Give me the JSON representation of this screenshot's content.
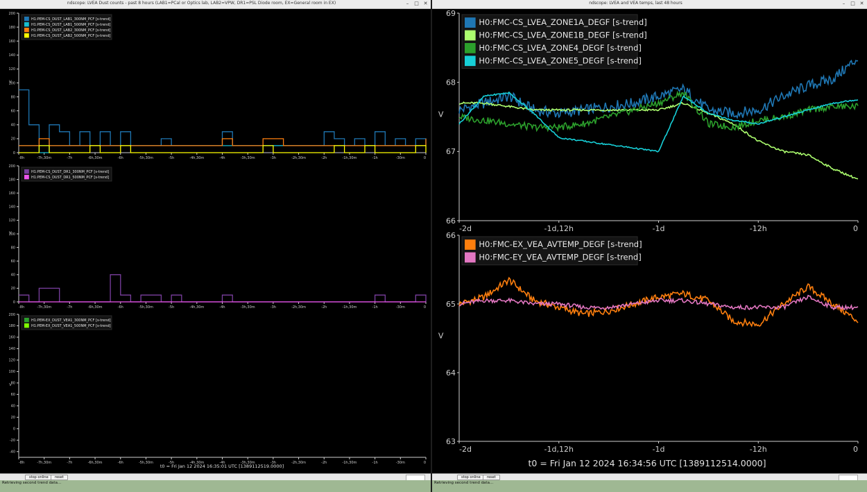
{
  "left_window": {
    "title": "ndscope: LVEA Dust counts - past 8 hours (LAB1=PCal or Optics lab, LAB2=VPW, DR1=PSL Diode room, EX=General room in EX)",
    "t0": "t0 = Fri Jan 12 2024 16:35:01 UTC [1389112519.0000]",
    "stop_label": "stop online",
    "reset_label": "reset",
    "status": "Retrieving second trend data...",
    "ylabel": "V",
    "x_ticks": [
      "-8h",
      "-7h,30m",
      "-7h",
      "-6h,30m",
      "-6h",
      "-5h,30m",
      "-5h",
      "-4h,30m",
      "-4h",
      "-3h,30m",
      "-3h",
      "-2h,30m",
      "-2h",
      "-1h,30m",
      "-1h",
      "-30m",
      "0"
    ],
    "panels": [
      {
        "ylim": [
          0,
          200
        ],
        "y_ticks": [
          0,
          20,
          40,
          60,
          80,
          100,
          120,
          140,
          160,
          180,
          200
        ],
        "legend": [
          {
            "name": "H1:PEM-CS_DUST_LAB1_300NM_PCF [s-trend]",
            "color": "#1f77b4"
          },
          {
            "name": "H1:PEM-CS_DUST_LAB1_500NM_PCF [s-trend]",
            "color": "#17becf"
          },
          {
            "name": "H1:PEM-CS_DUST_LAB2_300NM_PCF [s-trend]",
            "color": "#ff7f0e"
          },
          {
            "name": "H1:PEM-CS_DUST_LAB2_500NM_PCF [s-trend]",
            "color": "#ffff00"
          }
        ]
      },
      {
        "ylim": [
          0,
          200
        ],
        "y_ticks": [
          0,
          20,
          40,
          60,
          80,
          100,
          120,
          140,
          160,
          180,
          200
        ],
        "legend": [
          {
            "name": "H1:PEM-CS_DUST_DR1_300NM_PCF [s-trend]",
            "color": "#7b3fa0"
          },
          {
            "name": "H1:PEM-CS_DUST_DR1_500NM_PCF [s-trend]",
            "color": "#ee55ee"
          }
        ]
      },
      {
        "ylim": [
          -50,
          200
        ],
        "y_ticks": [
          -40,
          -20,
          0,
          20,
          40,
          60,
          80,
          100,
          120,
          140,
          160,
          180,
          200
        ],
        "legend": [
          {
            "name": "H1:PEM-EX_DUST_VEA1_300NM_PCF [s-trend]",
            "color": "#2ca02c"
          },
          {
            "name": "H1:PEM-EX_DUST_VEA1_500NM_PCF [s-trend]",
            "color": "#7fff00"
          }
        ]
      }
    ]
  },
  "right_window": {
    "title": "ndscope: LVEA and VEA temps, last 48 hours",
    "t0": "t0 = Fri Jan 12 2024 16:34:56 UTC [1389112514.0000]",
    "stop_label": "stop online",
    "reset_label": "reset",
    "status": "Retrieving second trend data...",
    "ylabel": "V",
    "x_ticks": [
      "-2d",
      "-1d,12h",
      "-1d",
      "-12h",
      "0"
    ],
    "panels": [
      {
        "ylim": [
          66,
          69
        ],
        "y_ticks": [
          66,
          67,
          68,
          69
        ],
        "legend": [
          {
            "name": "H0:FMC-CS_LVEA_ZONE1A_DEGF [s-trend]",
            "color": "#1f77b4"
          },
          {
            "name": "H0:FMC-CS_LVEA_ZONE1B_DEGF [s-trend]",
            "color": "#adff6f"
          },
          {
            "name": "H0:FMC-CS_LVEA_ZONE4_DEGF [s-trend]",
            "color": "#2ca02c"
          },
          {
            "name": "H0:FMC-CS_LVEA_ZONE5_DEGF [s-trend]",
            "color": "#17d0d8"
          }
        ]
      },
      {
        "ylim": [
          63,
          66
        ],
        "y_ticks": [
          63,
          64,
          65,
          66
        ],
        "legend": [
          {
            "name": "H0:FMC-EX_VEA_AVTEMP_DEGF [s-trend]",
            "color": "#ff7f0e"
          },
          {
            "name": "H0:FMC-EY_VEA_AVTEMP_DEGF [s-trend]",
            "color": "#e377c2"
          }
        ]
      }
    ]
  },
  "chart_data": [
    {
      "type": "line",
      "xlabel": "",
      "ylabel": "V",
      "ylim": [
        0,
        200
      ],
      "x": [
        -8,
        -7.8,
        -7.6,
        -7.4,
        -7.2,
        -7,
        -6.8,
        -6.6,
        -6.4,
        -6.2,
        -6,
        -5.8,
        -5.6,
        -5.4,
        -5.2,
        -5,
        -4.8,
        -4.6,
        -4.4,
        -4.2,
        -4,
        -3.8,
        -3.6,
        -3.4,
        -3.2,
        -3,
        -2.8,
        -2.6,
        -2.4,
        -2.2,
        -2,
        -1.8,
        -1.6,
        -1.4,
        -1.2,
        -1,
        -0.8,
        -0.6,
        -0.4,
        -0.2,
        0
      ],
      "series": [
        {
          "name": "H1:PEM-CS_DUST_LAB1_300NM_PCF [s-trend]",
          "values": [
            90,
            40,
            10,
            40,
            30,
            10,
            30,
            10,
            30,
            10,
            30,
            10,
            10,
            10,
            20,
            10,
            10,
            10,
            10,
            10,
            30,
            10,
            10,
            10,
            10,
            10,
            10,
            10,
            10,
            10,
            30,
            20,
            10,
            20,
            10,
            30,
            10,
            20,
            10,
            20,
            10
          ]
        },
        {
          "name": "H1:PEM-CS_DUST_LAB1_500NM_PCF [s-trend]",
          "values": [
            10,
            10,
            0,
            10,
            10,
            10,
            10,
            10,
            10,
            10,
            10,
            10,
            10,
            10,
            10,
            10,
            10,
            10,
            10,
            10,
            10,
            10,
            10,
            10,
            10,
            10,
            10,
            10,
            10,
            10,
            10,
            10,
            10,
            10,
            10,
            10,
            10,
            10,
            10,
            10,
            10
          ]
        },
        {
          "name": "H1:PEM-CS_DUST_LAB2_300NM_PCF [s-trend]",
          "values": [
            10,
            10,
            20,
            10,
            10,
            10,
            10,
            10,
            10,
            10,
            10,
            10,
            10,
            10,
            10,
            10,
            10,
            10,
            10,
            10,
            20,
            10,
            10,
            10,
            20,
            20,
            10,
            10,
            10,
            10,
            10,
            10,
            10,
            10,
            10,
            10,
            10,
            10,
            10,
            10,
            20
          ]
        },
        {
          "name": "H1:PEM-CS_DUST_LAB2_500NM_PCF [s-trend]",
          "values": [
            0,
            0,
            10,
            0,
            0,
            0,
            0,
            10,
            0,
            0,
            10,
            0,
            0,
            0,
            0,
            0,
            0,
            0,
            0,
            0,
            0,
            0,
            0,
            0,
            10,
            0,
            0,
            0,
            0,
            0,
            0,
            10,
            0,
            0,
            10,
            0,
            0,
            0,
            0,
            10,
            0
          ]
        }
      ]
    },
    {
      "type": "line",
      "xlabel": "",
      "ylabel": "V",
      "ylim": [
        0,
        200
      ],
      "x": [
        -8,
        -7.8,
        -7.6,
        -7.4,
        -7.2,
        -7,
        -6.8,
        -6.6,
        -6.4,
        -6.2,
        -6,
        -5.8,
        -5.6,
        -5.4,
        -5.2,
        -5,
        -4.8,
        -4.6,
        -4.4,
        -4.2,
        -4,
        -3.8,
        -3.6,
        -3.4,
        -3.2,
        -3,
        -2.8,
        -2.6,
        -2.4,
        -2.2,
        -2,
        -1.8,
        -1.6,
        -1.4,
        -1.2,
        -1,
        -0.8,
        -0.6,
        -0.4,
        -0.2,
        0
      ],
      "series": [
        {
          "name": "H1:PEM-CS_DUST_DR1_300NM_PCF [s-trend]",
          "values": [
            10,
            0,
            20,
            20,
            0,
            0,
            0,
            0,
            0,
            40,
            10,
            0,
            10,
            10,
            0,
            10,
            0,
            0,
            0,
            0,
            10,
            0,
            0,
            0,
            0,
            0,
            0,
            0,
            0,
            0,
            0,
            0,
            0,
            0,
            0,
            10,
            0,
            0,
            0,
            10,
            0
          ]
        },
        {
          "name": "H1:PEM-CS_DUST_DR1_500NM_PCF [s-trend]",
          "values": [
            0,
            0,
            0,
            0,
            0,
            0,
            0,
            0,
            0,
            0,
            0,
            0,
            0,
            0,
            0,
            0,
            0,
            0,
            0,
            0,
            0,
            0,
            0,
            0,
            0,
            0,
            0,
            0,
            0,
            0,
            0,
            0,
            0,
            0,
            0,
            0,
            0,
            0,
            0,
            0,
            0
          ]
        }
      ]
    },
    {
      "type": "line",
      "xlabel": "",
      "ylabel": "V",
      "ylim": [
        -50,
        200
      ],
      "x": [
        -8,
        0
      ],
      "series": [
        {
          "name": "H1:PEM-EX_DUST_VEA1_300NM_PCF [s-trend]",
          "values": []
        },
        {
          "name": "H1:PEM-EX_DUST_VEA1_500NM_PCF [s-trend]",
          "values": []
        }
      ]
    },
    {
      "type": "line",
      "xlabel": "",
      "ylabel": "V",
      "ylim": [
        66,
        69
      ],
      "x": [
        -48,
        -45,
        -42,
        -39,
        -36,
        -33,
        -30,
        -27,
        -24,
        -21,
        -18,
        -15,
        -12,
        -9,
        -6,
        -3,
        0
      ],
      "series": [
        {
          "name": "H0:FMC-CS_LVEA_ZONE1A_DEGF [s-trend]",
          "values": [
            67.6,
            67.7,
            67.8,
            67.6,
            67.55,
            67.6,
            67.65,
            67.7,
            67.8,
            67.9,
            67.6,
            67.55,
            67.6,
            67.8,
            67.95,
            68.05,
            68.35
          ]
        },
        {
          "name": "H0:FMC-CS_LVEA_ZONE1B_DEGF [s-trend]",
          "values": [
            67.7,
            67.7,
            67.65,
            67.6,
            67.6,
            67.6,
            67.6,
            67.6,
            67.6,
            67.7,
            67.55,
            67.4,
            67.15,
            67.0,
            66.95,
            66.75,
            66.6
          ]
        },
        {
          "name": "H0:FMC-CS_LVEA_ZONE4_DEGF [s-trend]",
          "values": [
            67.5,
            67.45,
            67.4,
            67.35,
            67.35,
            67.4,
            67.5,
            67.6,
            67.7,
            67.85,
            67.4,
            67.35,
            67.45,
            67.5,
            67.6,
            67.65,
            67.65
          ]
        },
        {
          "name": "H0:FMC-CS_LVEA_ZONE5_DEGF [s-trend]",
          "values": [
            67.4,
            67.8,
            67.85,
            67.55,
            67.2,
            67.15,
            67.1,
            67.05,
            67.0,
            67.8,
            67.55,
            67.45,
            67.4,
            67.5,
            67.6,
            67.7,
            67.75
          ]
        }
      ]
    },
    {
      "type": "line",
      "xlabel": "",
      "ylabel": "V",
      "ylim": [
        63,
        66
      ],
      "x": [
        -48,
        -45,
        -42,
        -39,
        -36,
        -33,
        -30,
        -27,
        -24,
        -21,
        -18,
        -15,
        -12,
        -9,
        -6,
        -3,
        0
      ],
      "series": [
        {
          "name": "H0:FMC-EX_VEA_AVTEMP_DEGF [s-trend]",
          "values": [
            65.0,
            65.1,
            65.35,
            65.05,
            64.95,
            64.85,
            64.9,
            65.0,
            65.1,
            65.15,
            65.05,
            64.75,
            64.7,
            65.0,
            65.25,
            65.0,
            64.75
          ]
        },
        {
          "name": "H0:FMC-EY_VEA_AVTEMP_DEGF [s-trend]",
          "values": [
            65.0,
            65.05,
            65.05,
            65.0,
            65.0,
            64.95,
            64.95,
            65.0,
            65.05,
            65.05,
            65.0,
            64.95,
            64.95,
            64.95,
            65.1,
            64.95,
            64.95
          ]
        }
      ]
    }
  ]
}
